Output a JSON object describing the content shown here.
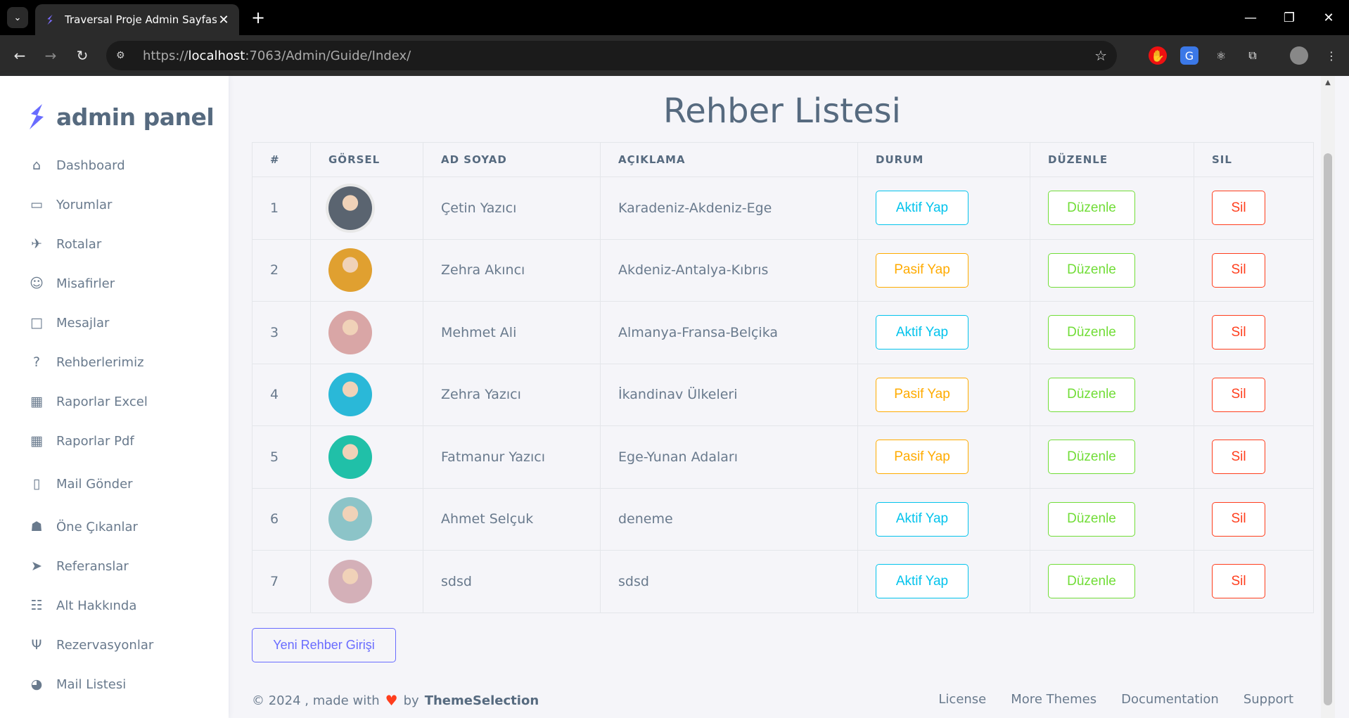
{
  "browser": {
    "tab_title": "Traversal Proje Admin Sayfası",
    "url_prefix": "https://",
    "url_host": "localhost",
    "url_path": ":7063/Admin/Guide/Index/",
    "icons": [
      "tab-list-icon",
      "favicon-icon",
      "close-icon",
      "plus-icon",
      "minimize-icon",
      "restore-icon",
      "window-close-icon",
      "back-icon",
      "forward-icon",
      "reload-icon",
      "site-info-icon",
      "star-icon",
      "extension-icon",
      "translate-icon",
      "react-icon",
      "puzzle-icon",
      "profile-avatar",
      "more-icon"
    ]
  },
  "sidebar": {
    "brand": "admin panel",
    "items": [
      {
        "label": "Dashboard",
        "icon": "home-icon"
      },
      {
        "label": "Yorumlar",
        "icon": "message-icon"
      },
      {
        "label": "Rotalar",
        "icon": "plane-icon"
      },
      {
        "label": "Misafirler",
        "icon": "face-icon"
      },
      {
        "label": "Mesajlar",
        "icon": "message-square-icon"
      },
      {
        "label": "Rehberlerimiz",
        "icon": "help-circle-icon"
      },
      {
        "label": "Raporlar Excel",
        "icon": "file-report-icon"
      },
      {
        "label": "Raporlar Pdf",
        "icon": "file-report-icon"
      },
      {
        "label": "Mail Gönder",
        "icon": "mobile-icon"
      },
      {
        "label": "Öne Çıkanlar",
        "icon": "ghost-icon"
      },
      {
        "label": "Referanslar",
        "icon": "send-icon"
      },
      {
        "label": "Alt Hakkında",
        "icon": "abacus-icon"
      },
      {
        "label": "Rezervasyonlar",
        "icon": "restaurant-icon"
      },
      {
        "label": "Mail Listesi",
        "icon": "cookie-icon"
      }
    ]
  },
  "main": {
    "title": "Rehber Listesi",
    "columns": [
      "#",
      "GÖRSEL",
      "AD SOYAD",
      "AÇIKLAMA",
      "DURUM",
      "DÜZENLE",
      "SIL"
    ],
    "rows": [
      {
        "num": "1",
        "name": "Çetin Yazıcı",
        "desc": "Karadeniz-Akdeniz-Ege",
        "status": "Aktif Yap",
        "status_type": "aktif",
        "edit": "Düzenle",
        "delete": "Sil",
        "avatar_color": "#5a6470"
      },
      {
        "num": "2",
        "name": "Zehra Akıncı",
        "desc": "Akdeniz-Antalya-Kıbrıs",
        "status": "Pasif Yap",
        "status_type": "pasif",
        "edit": "Düzenle",
        "delete": "Sil",
        "avatar_color": "#e0a030"
      },
      {
        "num": "3",
        "name": "Mehmet Ali",
        "desc": "Almanya-Fransa-Belçika",
        "status": "Aktif Yap",
        "status_type": "aktif",
        "edit": "Düzenle",
        "delete": "Sil",
        "avatar_color": "#d9a6a6"
      },
      {
        "num": "4",
        "name": "Zehra Yazıcı",
        "desc": "İkandinav Ülkeleri",
        "status": "Pasif Yap",
        "status_type": "pasif",
        "edit": "Düzenle",
        "delete": "Sil",
        "avatar_color": "#2ab8d8"
      },
      {
        "num": "5",
        "name": "Fatmanur Yazıcı",
        "desc": "Ege-Yunan Adaları",
        "status": "Pasif Yap",
        "status_type": "pasif",
        "edit": "Düzenle",
        "delete": "Sil",
        "avatar_color": "#20c0a8"
      },
      {
        "num": "6",
        "name": "Ahmet Selçuk",
        "desc": "deneme",
        "status": "Aktif Yap",
        "status_type": "aktif",
        "edit": "Düzenle",
        "delete": "Sil",
        "avatar_color": "#8cc4c8"
      },
      {
        "num": "7",
        "name": "sdsd",
        "desc": "sdsd",
        "status": "Aktif Yap",
        "status_type": "aktif",
        "edit": "Düzenle",
        "delete": "Sil",
        "avatar_color": "#d4b0b8"
      }
    ],
    "new_button": "Yeni Rehber Girişi"
  },
  "footer": {
    "copyright": "© 2024 , made with",
    "by": "by",
    "brand": "ThemeSelection",
    "links": [
      "License",
      "More Themes",
      "Documentation",
      "Support"
    ]
  },
  "colors": {
    "primary": "#696cff",
    "info": "#03c3ec",
    "warning": "#ffab00",
    "success": "#71dd37",
    "danger": "#ff3e1d"
  }
}
